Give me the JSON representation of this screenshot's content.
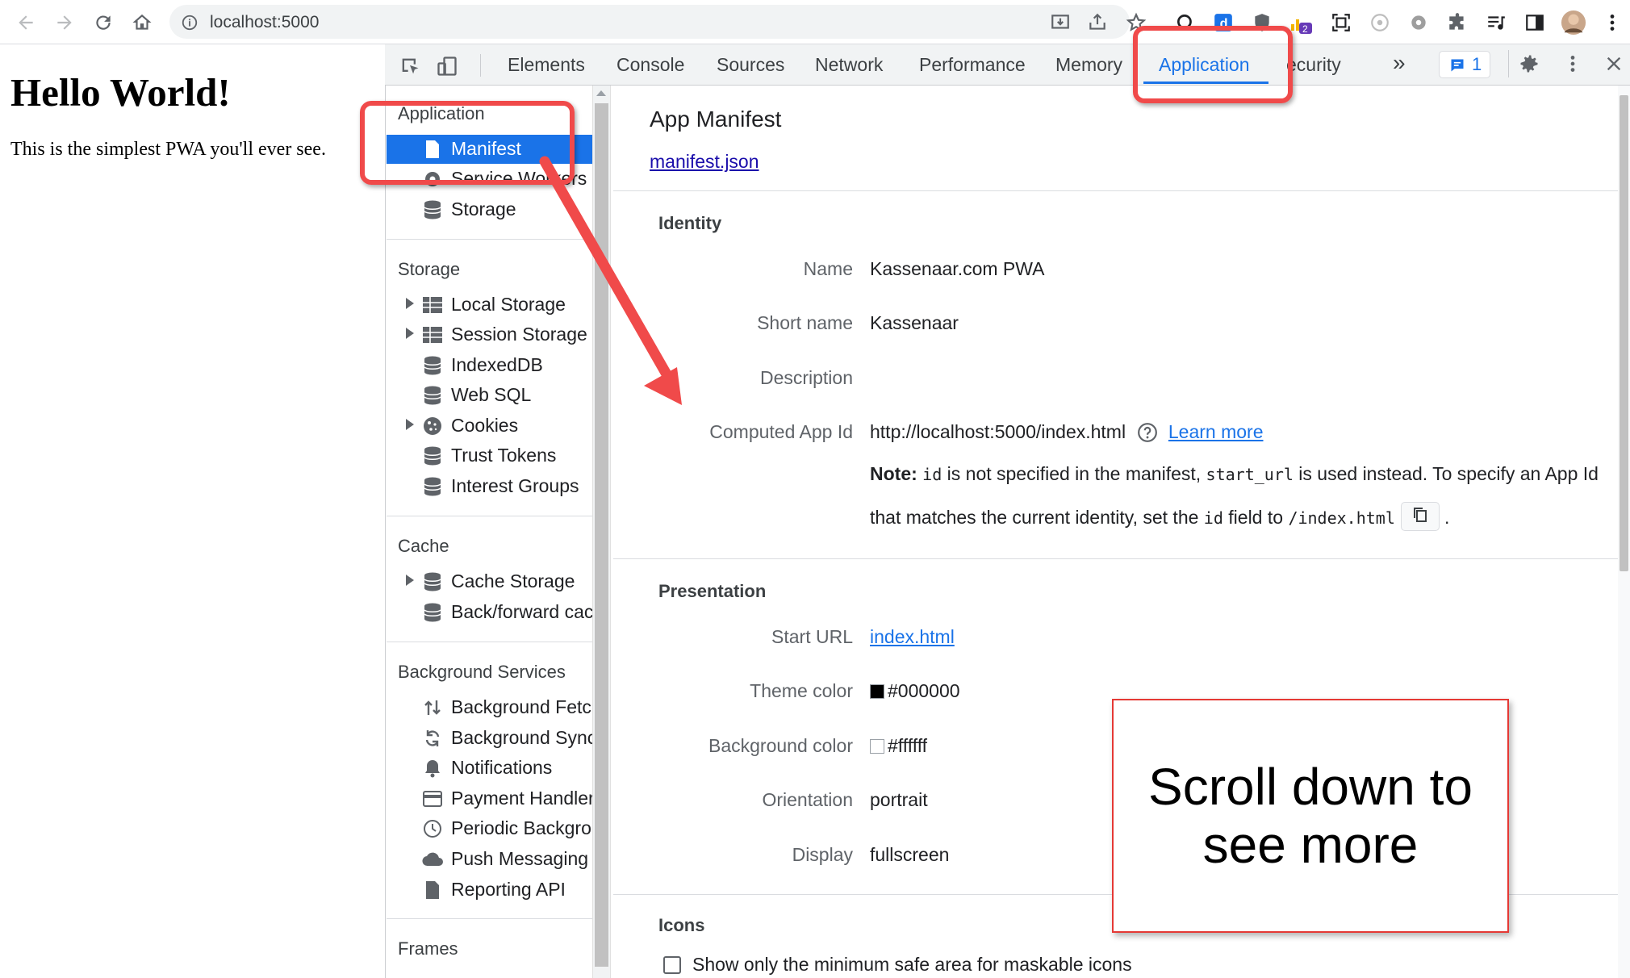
{
  "browser": {
    "url": "localhost:5000",
    "extension_badge": "2"
  },
  "page": {
    "heading": "Hello World!",
    "text": "This is the simplest PWA you'll ever see."
  },
  "devtools": {
    "tabs": [
      "Elements",
      "Console",
      "Sources",
      "Network",
      "Performance",
      "Memory",
      "Application",
      "ecurity"
    ],
    "active_tab": "Application",
    "more_tabs": "»",
    "issues_count": "1"
  },
  "sidebar": {
    "application": {
      "title": "Application",
      "items": [
        {
          "label": "Manifest",
          "icon": "file-icon",
          "selected": true
        },
        {
          "label": "Service Workers",
          "icon": "gear-icon"
        },
        {
          "label": "Storage",
          "icon": "database-icon"
        }
      ]
    },
    "storage": {
      "title": "Storage",
      "items": [
        {
          "label": "Local Storage",
          "icon": "grid-icon",
          "expandable": true
        },
        {
          "label": "Session Storage",
          "icon": "grid-icon",
          "expandable": true
        },
        {
          "label": "IndexedDB",
          "icon": "database-icon"
        },
        {
          "label": "Web SQL",
          "icon": "database-icon"
        },
        {
          "label": "Cookies",
          "icon": "cookie-icon",
          "expandable": true
        },
        {
          "label": "Trust Tokens",
          "icon": "database-icon"
        },
        {
          "label": "Interest Groups",
          "icon": "database-icon"
        }
      ]
    },
    "cache": {
      "title": "Cache",
      "items": [
        {
          "label": "Cache Storage",
          "icon": "database-icon",
          "expandable": true
        },
        {
          "label": "Back/forward cacl",
          "icon": "database-icon"
        }
      ]
    },
    "background": {
      "title": "Background Services",
      "items": [
        {
          "label": "Background Fetch",
          "icon": "arrows-updown-icon"
        },
        {
          "label": "Background Sync",
          "icon": "sync-icon"
        },
        {
          "label": "Notifications",
          "icon": "bell-icon"
        },
        {
          "label": "Payment Handler",
          "icon": "card-icon"
        },
        {
          "label": "Periodic Backgrou",
          "icon": "clock-icon"
        },
        {
          "label": "Push Messaging",
          "icon": "cloud-icon"
        },
        {
          "label": "Reporting API",
          "icon": "file-icon"
        }
      ]
    },
    "frames": {
      "title": "Frames"
    }
  },
  "manifest": {
    "title": "App Manifest",
    "link": "manifest.json",
    "identity": {
      "heading": "Identity",
      "name_label": "Name",
      "name_value": "Kassenaar.com PWA",
      "short_name_label": "Short name",
      "short_name_value": "Kassenaar",
      "description_label": "Description",
      "app_id_label": "Computed App Id",
      "app_id_value": "http://localhost:5000/index.html",
      "learn_more": "Learn more",
      "note_bold": "Note:",
      "note_code1": "id",
      "note_text1": " is not specified in the manifest, ",
      "note_code2": "start_url",
      "note_text2": " is used instead. To specify an App Id",
      "note_text3": "that matches the current identity, set the ",
      "note_code3": "id",
      "note_text4": " field to ",
      "note_code4": "/index.html",
      "note_end": "."
    },
    "presentation": {
      "heading": "Presentation",
      "start_url_label": "Start URL",
      "start_url_value": "index.html",
      "theme_color_label": "Theme color",
      "theme_color_value": "#000000",
      "background_color_label": "Background color",
      "background_color_value": "#ffffff",
      "orientation_label": "Orientation",
      "orientation_value": "portrait",
      "display_label": "Display",
      "display_value": "fullscreen"
    },
    "icons": {
      "heading": "Icons",
      "maskable_label": "Show only the minimum safe area for maskable icons"
    }
  },
  "annotation": {
    "callout": "Scroll down to see more",
    "colors": {
      "highlight": "#f04a4a",
      "arrow": "#f04a4a"
    }
  },
  "theme": {
    "accent": "#1a73e8",
    "link": "#1a0dab"
  }
}
